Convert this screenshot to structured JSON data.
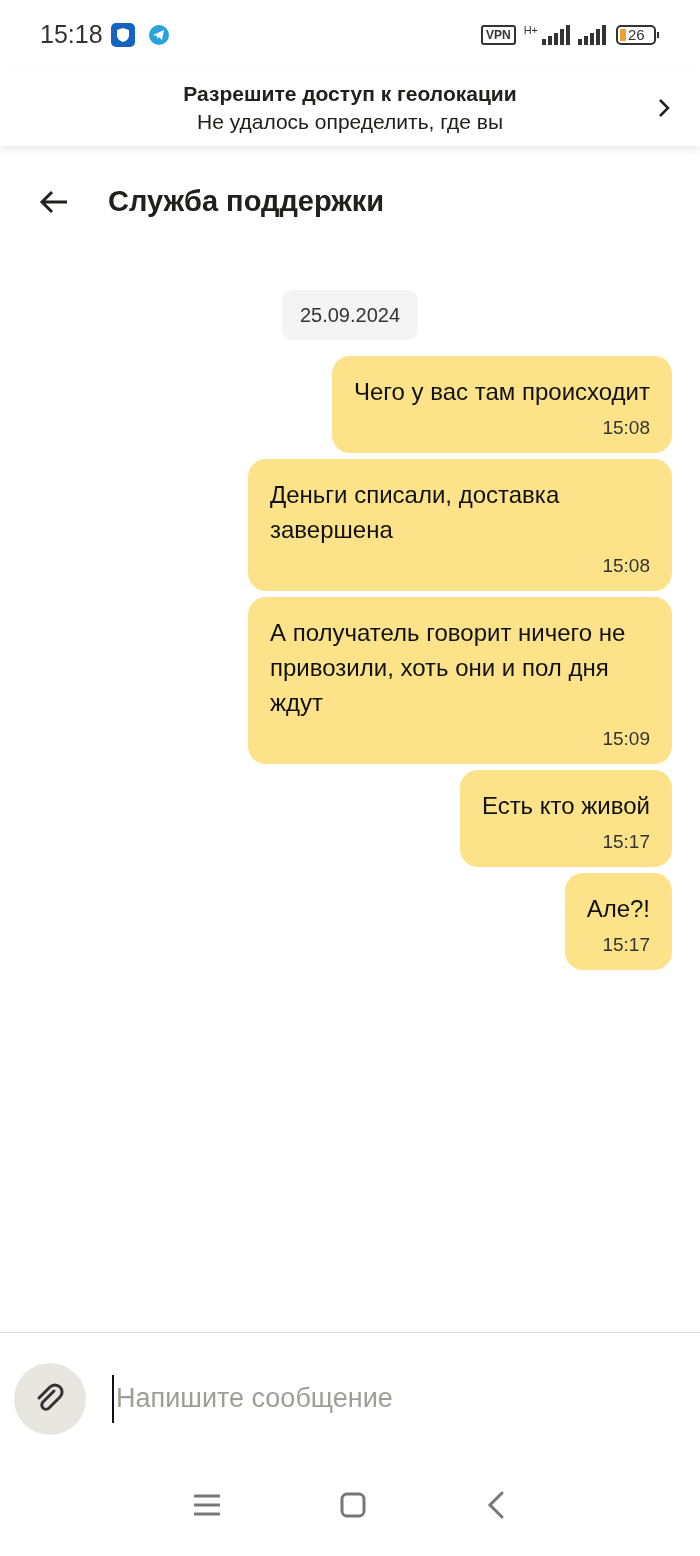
{
  "status_bar": {
    "time": "15:18",
    "vpn": "VPN",
    "network": "H+",
    "battery": "26"
  },
  "location_banner": {
    "title": "Разрешите доступ к геолокации",
    "subtitle": "Не удалось определить, где вы"
  },
  "header": {
    "title": "Служба поддержки"
  },
  "date": "25.09.2024",
  "messages": [
    {
      "text": "Чего у вас там происходит",
      "time": "15:08"
    },
    {
      "text": "Деньги списали, доставка завершена",
      "time": "15:08"
    },
    {
      "text": "А получатель говорит ничего не привозили, хоть они и пол дня ждут",
      "time": "15:09"
    },
    {
      "text": "Есть кто живой",
      "time": "15:17"
    },
    {
      "text": "Але?!",
      "time": "15:17"
    }
  ],
  "composer": {
    "placeholder": "Напишите сообщение"
  }
}
